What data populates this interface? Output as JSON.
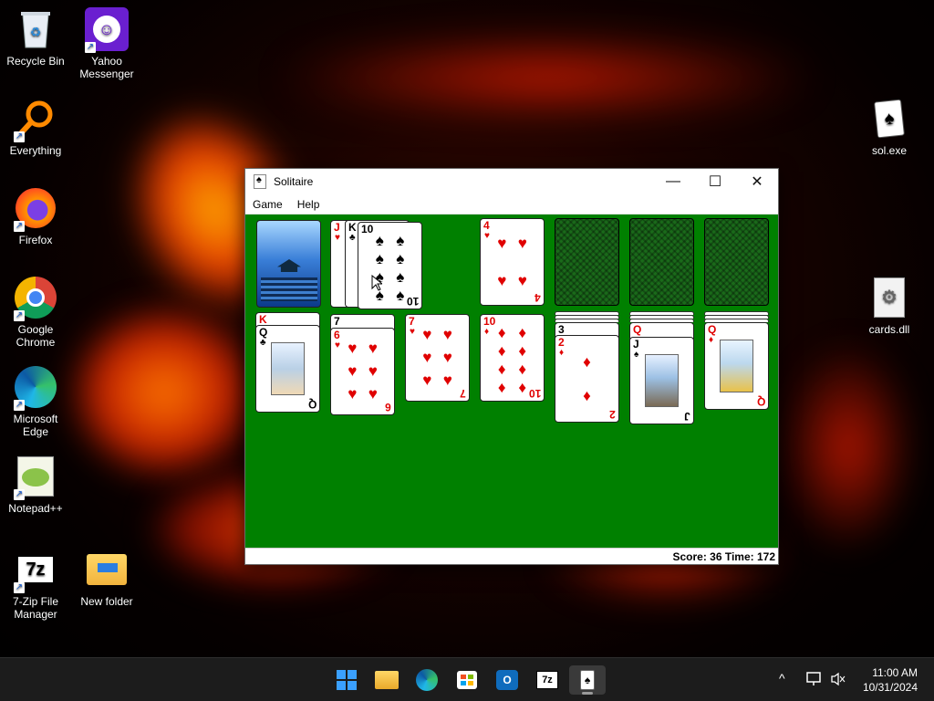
{
  "desktop": {
    "icons": [
      {
        "label": "Recycle Bin",
        "icon": "recycle-bin-icon"
      },
      {
        "label": "Yahoo Messenger",
        "icon": "yahoo-messenger-icon"
      },
      {
        "label": "Everything",
        "icon": "everything-search-icon"
      },
      {
        "label": "Firefox",
        "icon": "firefox-icon"
      },
      {
        "label": "Google Chrome",
        "icon": "chrome-icon"
      },
      {
        "label": "Microsoft Edge",
        "icon": "edge-icon"
      },
      {
        "label": "Notepad++",
        "icon": "notepad-plus-plus-icon"
      },
      {
        "label": "7-Zip File Manager",
        "icon": "seven-zip-icon"
      },
      {
        "label": "New folder",
        "icon": "folder-icon"
      },
      {
        "label": "sol.exe",
        "icon": "solitaire-exe-icon"
      },
      {
        "label": "cards.dll",
        "icon": "dll-file-icon"
      }
    ]
  },
  "window": {
    "title": "Solitaire",
    "menu": [
      "Game",
      "Help"
    ],
    "controls": {
      "minimize": "—",
      "maximize": "☐",
      "close": "✕"
    },
    "status": "Score: 36 Time: 172"
  },
  "solitaire": {
    "felt_color": "#008000",
    "stock": "card-back-pier",
    "waste": [
      {
        "rank": "J",
        "suit": "♥"
      },
      {
        "rank": "K",
        "suit": "♣"
      },
      {
        "rank": "10",
        "suit": "♠"
      }
    ],
    "foundations": [
      {
        "rank": "4",
        "suit": "♥"
      },
      {
        "rank": "",
        "suit": ""
      },
      {
        "rank": "",
        "suit": ""
      },
      {
        "rank": "",
        "suit": ""
      }
    ],
    "tableau": [
      {
        "cards": [
          {
            "rank": "K",
            "suit": "♥"
          },
          {
            "rank": "Q",
            "suit": "♣"
          }
        ]
      },
      {
        "cards": [
          {
            "rank": "7",
            "suit": "♠"
          },
          {
            "rank": "6",
            "suit": "♥"
          }
        ]
      },
      {
        "cards": [
          {
            "rank": "7",
            "suit": "♥"
          }
        ]
      },
      {
        "cards": [
          {
            "rank": "10",
            "suit": "♦"
          }
        ]
      },
      {
        "cards": [
          {
            "rank": "3",
            "suit": "♠"
          },
          {
            "rank": "2",
            "suit": "♦"
          }
        ]
      },
      {
        "cards": [
          {
            "rank": "Q",
            "suit": "♥"
          },
          {
            "rank": "J",
            "suit": "♠"
          }
        ]
      },
      {
        "cards": [
          {
            "rank": "Q",
            "suit": "♦"
          }
        ]
      }
    ]
  },
  "taskbar": {
    "apps": [
      "start-icon",
      "file-explorer-icon",
      "edge-icon",
      "store-icon",
      "outlook-icon",
      "seven-zip-icon",
      "solitaire-icon"
    ],
    "tray_up": "^",
    "time": "11:00 AM",
    "date": "10/31/2024"
  }
}
